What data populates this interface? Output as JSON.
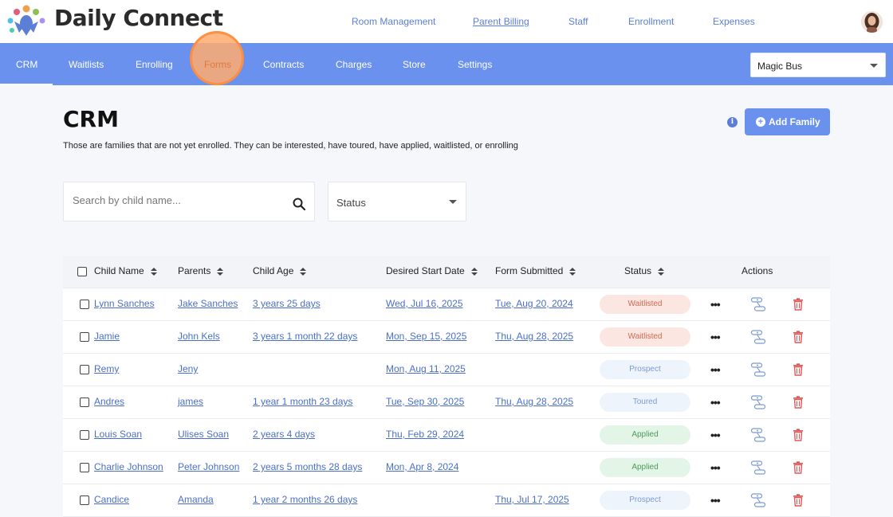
{
  "brand": {
    "name": "Daily Connect"
  },
  "top_nav": [
    {
      "label": "Room Management",
      "active": false
    },
    {
      "label": "Parent Billing",
      "active": true
    },
    {
      "label": "Staff",
      "active": false
    },
    {
      "label": "Enrollment",
      "active": false
    },
    {
      "label": "Expenses",
      "active": false
    }
  ],
  "sub_nav": {
    "items": [
      "CRM",
      "Waitlists",
      "Enrolling",
      "Forms",
      "Contracts",
      "Charges",
      "Store",
      "Settings"
    ],
    "active": "CRM",
    "highlighted": "Forms"
  },
  "school_select": {
    "value": "Magic Bus"
  },
  "page": {
    "title": "CRM",
    "subtitle": "Those are families that are not yet enrolled. They can be interested, have toured, have applied, waitlisted, or enrolling",
    "info_icon_glyph": "i",
    "add_button_label": "Add Family"
  },
  "filters": {
    "search_placeholder": "Search by child name...",
    "status_label": "Status"
  },
  "table": {
    "headers": {
      "child_name": "Child Name",
      "parents": "Parents",
      "child_age": "Child Age",
      "desired_start": "Desired Start Date",
      "form_submitted": "Form Submitted",
      "status": "Status",
      "actions": "Actions"
    },
    "rows": [
      {
        "child": "Lynn Sanches",
        "parents": "Jake Sanches",
        "age": "3 years 25 days",
        "start": "Wed, Jul 16, 2025",
        "submitted": "Tue, Aug 20, 2024",
        "status": "Waitlisted",
        "status_key": "waitlisted"
      },
      {
        "child": "Jamie",
        "parents": "John Kels",
        "age": "3 years 1 month 22 days",
        "start": "Mon, Sep 15, 2025",
        "submitted": "Thu, Aug 28, 2025",
        "status": "Waitlisted",
        "status_key": "waitlisted"
      },
      {
        "child": "Remy",
        "parents": "Jeny",
        "age": "",
        "start": "Mon, Aug 11, 2025",
        "submitted": "",
        "status": "Prospect",
        "status_key": "prospect"
      },
      {
        "child": "Andres",
        "parents": "james",
        "age": "1 year 1 month 23 days",
        "start": "Tue, Sep 30, 2025",
        "submitted": "Thu, Aug 28, 2025",
        "status": "Toured",
        "status_key": "toured"
      },
      {
        "child": "Louis Soan",
        "parents": "Ulises Soan",
        "age": "2 years 4 days",
        "start": "Thu, Feb 29, 2024",
        "submitted": "",
        "status": "Applied",
        "status_key": "applied"
      },
      {
        "child": "Charlie Johnson",
        "parents": "Peter Johnson",
        "age": "2 years 5 months 28 days",
        "start": "Mon, Apr 8, 2024",
        "submitted": "",
        "status": "Applied",
        "status_key": "applied"
      },
      {
        "child": "Candice",
        "parents": "Amanda",
        "age": "1 year 2 months 26 days",
        "start": "",
        "submitted": "Thu, Jul 17, 2025",
        "status": "Prospect",
        "status_key": "prospect"
      }
    ],
    "more_glyph": "•••"
  },
  "colors": {
    "accent": "#6a91ee",
    "link": "#4a6fc8",
    "waitlisted": "#d2694f",
    "applied": "#4e9a5e",
    "prospect": "#7c9ad0",
    "delete": "#e05a5a"
  },
  "icons": [
    "logo-icon",
    "avatar",
    "chevron-down-icon",
    "info-icon",
    "plus-circle-icon",
    "search-icon",
    "sort-icon",
    "more-icon",
    "link-icon",
    "trash-icon"
  ]
}
